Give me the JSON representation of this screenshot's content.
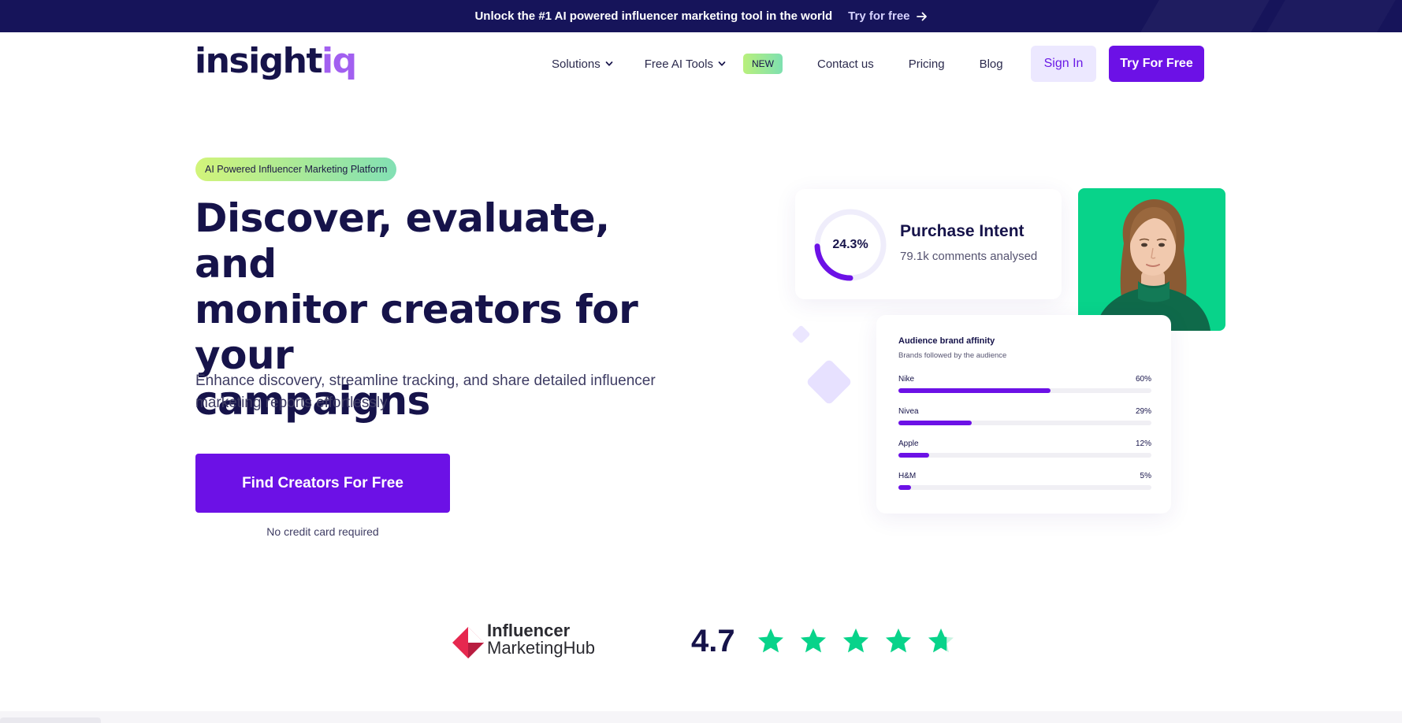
{
  "announcement": {
    "text": "Unlock the #1 AI powered influencer marketing tool in the world",
    "cta_label": "Try for free"
  },
  "logo": {
    "text_main": "insight",
    "text_accent": "iq"
  },
  "nav": {
    "items": [
      {
        "label": "Solutions",
        "has_dropdown": true
      },
      {
        "label": "Free AI Tools",
        "has_dropdown": true,
        "badge": "NEW"
      },
      {
        "label": "Contact us"
      },
      {
        "label": "Pricing"
      },
      {
        "label": "Blog"
      }
    ],
    "sign_in_label": "Sign In",
    "try_label": "Try For Free"
  },
  "hero": {
    "pill": "AI Powered Influencer Marketing Platform",
    "headline_lines": [
      "Discover, evaluate, and",
      "monitor creators for your",
      "campaigns"
    ],
    "subtext_lines": [
      "Enhance discovery, streamline tracking, and share detailed influencer",
      "marketing reports effortlessly"
    ],
    "cta_label": "Find Creators For Free",
    "note": "No credit card required"
  },
  "purchase_intent": {
    "value_label": "24.3%",
    "value": 0.243,
    "title": "Purchase Intent",
    "subtitle": "79.1k comments analysed"
  },
  "brand_affinity": {
    "title": "Audience brand affinity",
    "subtitle": "Brands followed by the audience",
    "brands": [
      {
        "name": "Nike",
        "pct_label": "60%",
        "pct": 60
      },
      {
        "name": "Nivea",
        "pct_label": "29%",
        "pct": 29
      },
      {
        "name": "Apple",
        "pct_label": "12%",
        "pct": 12
      },
      {
        "name": "H&M",
        "pct_label": "5%",
        "pct": 5
      }
    ]
  },
  "rating": {
    "source_line1": "Influencer",
    "source_line2": "MarketingHub",
    "score": "4.7",
    "stars_filled": 4.7,
    "stars_total": 5
  },
  "colors": {
    "brand_purple": "#6c11e6",
    "navy": "#16134a",
    "star_green": "#08d38a",
    "logo_accent": "#a260f0",
    "imh_red": "#e6284f"
  },
  "icons": {
    "announce_arrow": "arrow-right-icon",
    "dropdown": "chevron-down-icon",
    "star": "star-icon"
  }
}
